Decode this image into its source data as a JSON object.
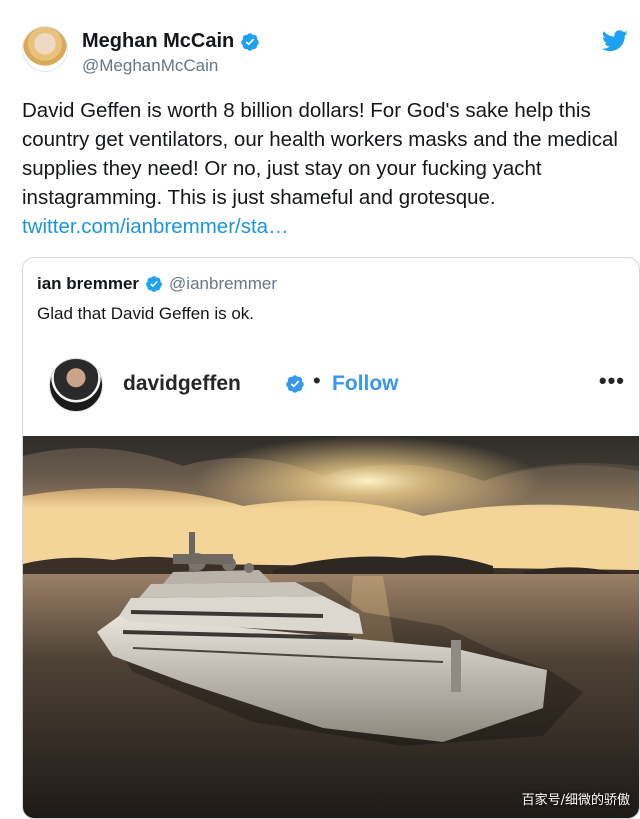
{
  "tweet": {
    "display_name": "Meghan McCain",
    "handle": "@MeghanMcCain",
    "text": "David Geffen is worth 8 billion dollars! For God's sake help this country get ventilators, our health workers masks and the medical supplies they need! Or no, just stay on your fucking yacht instagramming. This is just shameful and grotesque.",
    "link": "twitter.com/ianbremmer/sta…",
    "icons": {
      "verified": "verified-badge-icon",
      "platform": "twitter-bird-icon"
    },
    "colors": {
      "link": "#1b95e0",
      "verified": "#1da1f2",
      "handle": "#657786"
    }
  },
  "quoted": {
    "display_name": "ian bremmer",
    "handle": "@ianbremmer",
    "text": "Glad that David Geffen is ok.",
    "instagram": {
      "username": "davidgeffen",
      "separator": "•",
      "follow_label": "Follow",
      "more_label": "•••",
      "follow_color": "#3897f0"
    }
  },
  "watermark": "百家号/细微的骄傲"
}
